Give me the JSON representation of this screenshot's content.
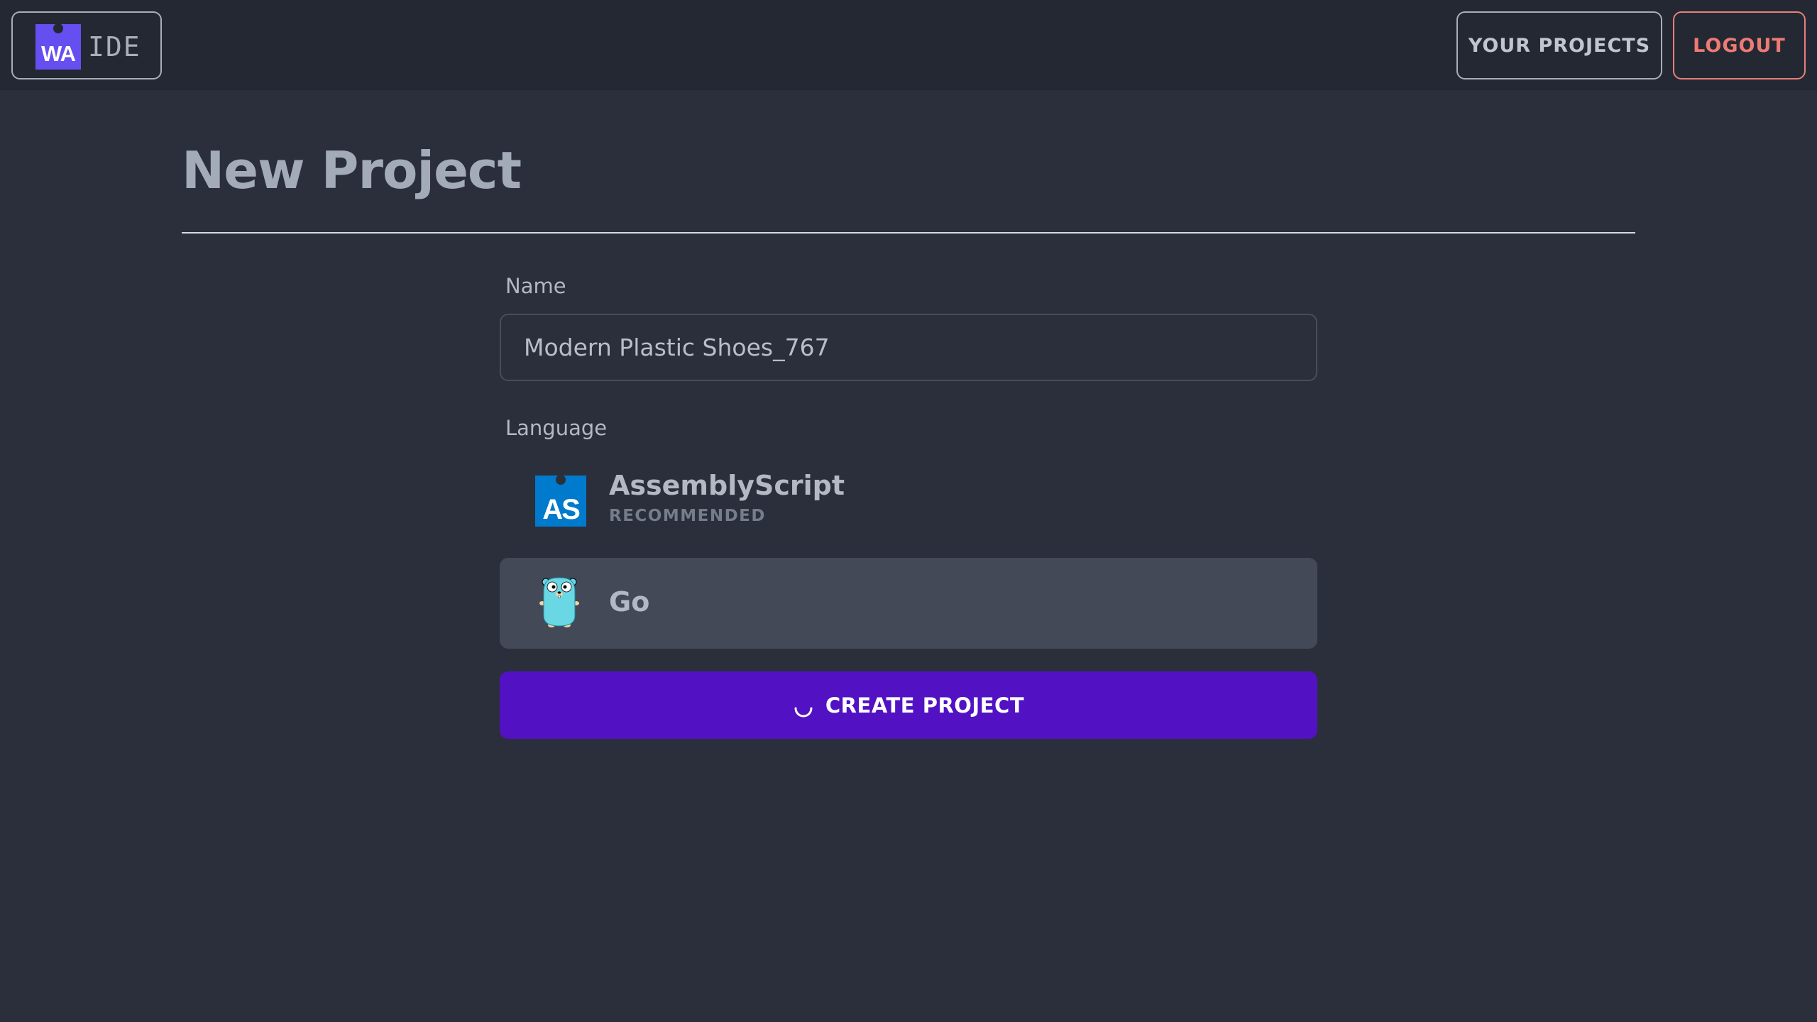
{
  "header": {
    "logo_mark": "WA",
    "logo_text": "IDE",
    "your_projects_label": "YOUR PROJECTS",
    "logout_label": "LOGOUT"
  },
  "page": {
    "title": "New Project"
  },
  "form": {
    "name_label": "Name",
    "name_value": "Modern Plastic Shoes_767",
    "language_label": "Language",
    "languages": [
      {
        "name": "AssemblyScript",
        "badge": "RECOMMENDED",
        "icon": "assemblyscript-logo-icon",
        "icon_text": "AS",
        "selected": false
      },
      {
        "name": "Go",
        "badge": "",
        "icon": "go-gopher-icon",
        "selected": true
      }
    ],
    "submit_label": "CREATE PROJECT",
    "submit_loading": true
  },
  "colors": {
    "background": "#2a2f3b",
    "header_background": "#242832",
    "accent_purple": "#5212c3",
    "logout_red": "#ee7a75",
    "webassembly_purple": "#654ff0",
    "assemblyscript_blue": "#007acc",
    "selected_option": "#434957"
  }
}
